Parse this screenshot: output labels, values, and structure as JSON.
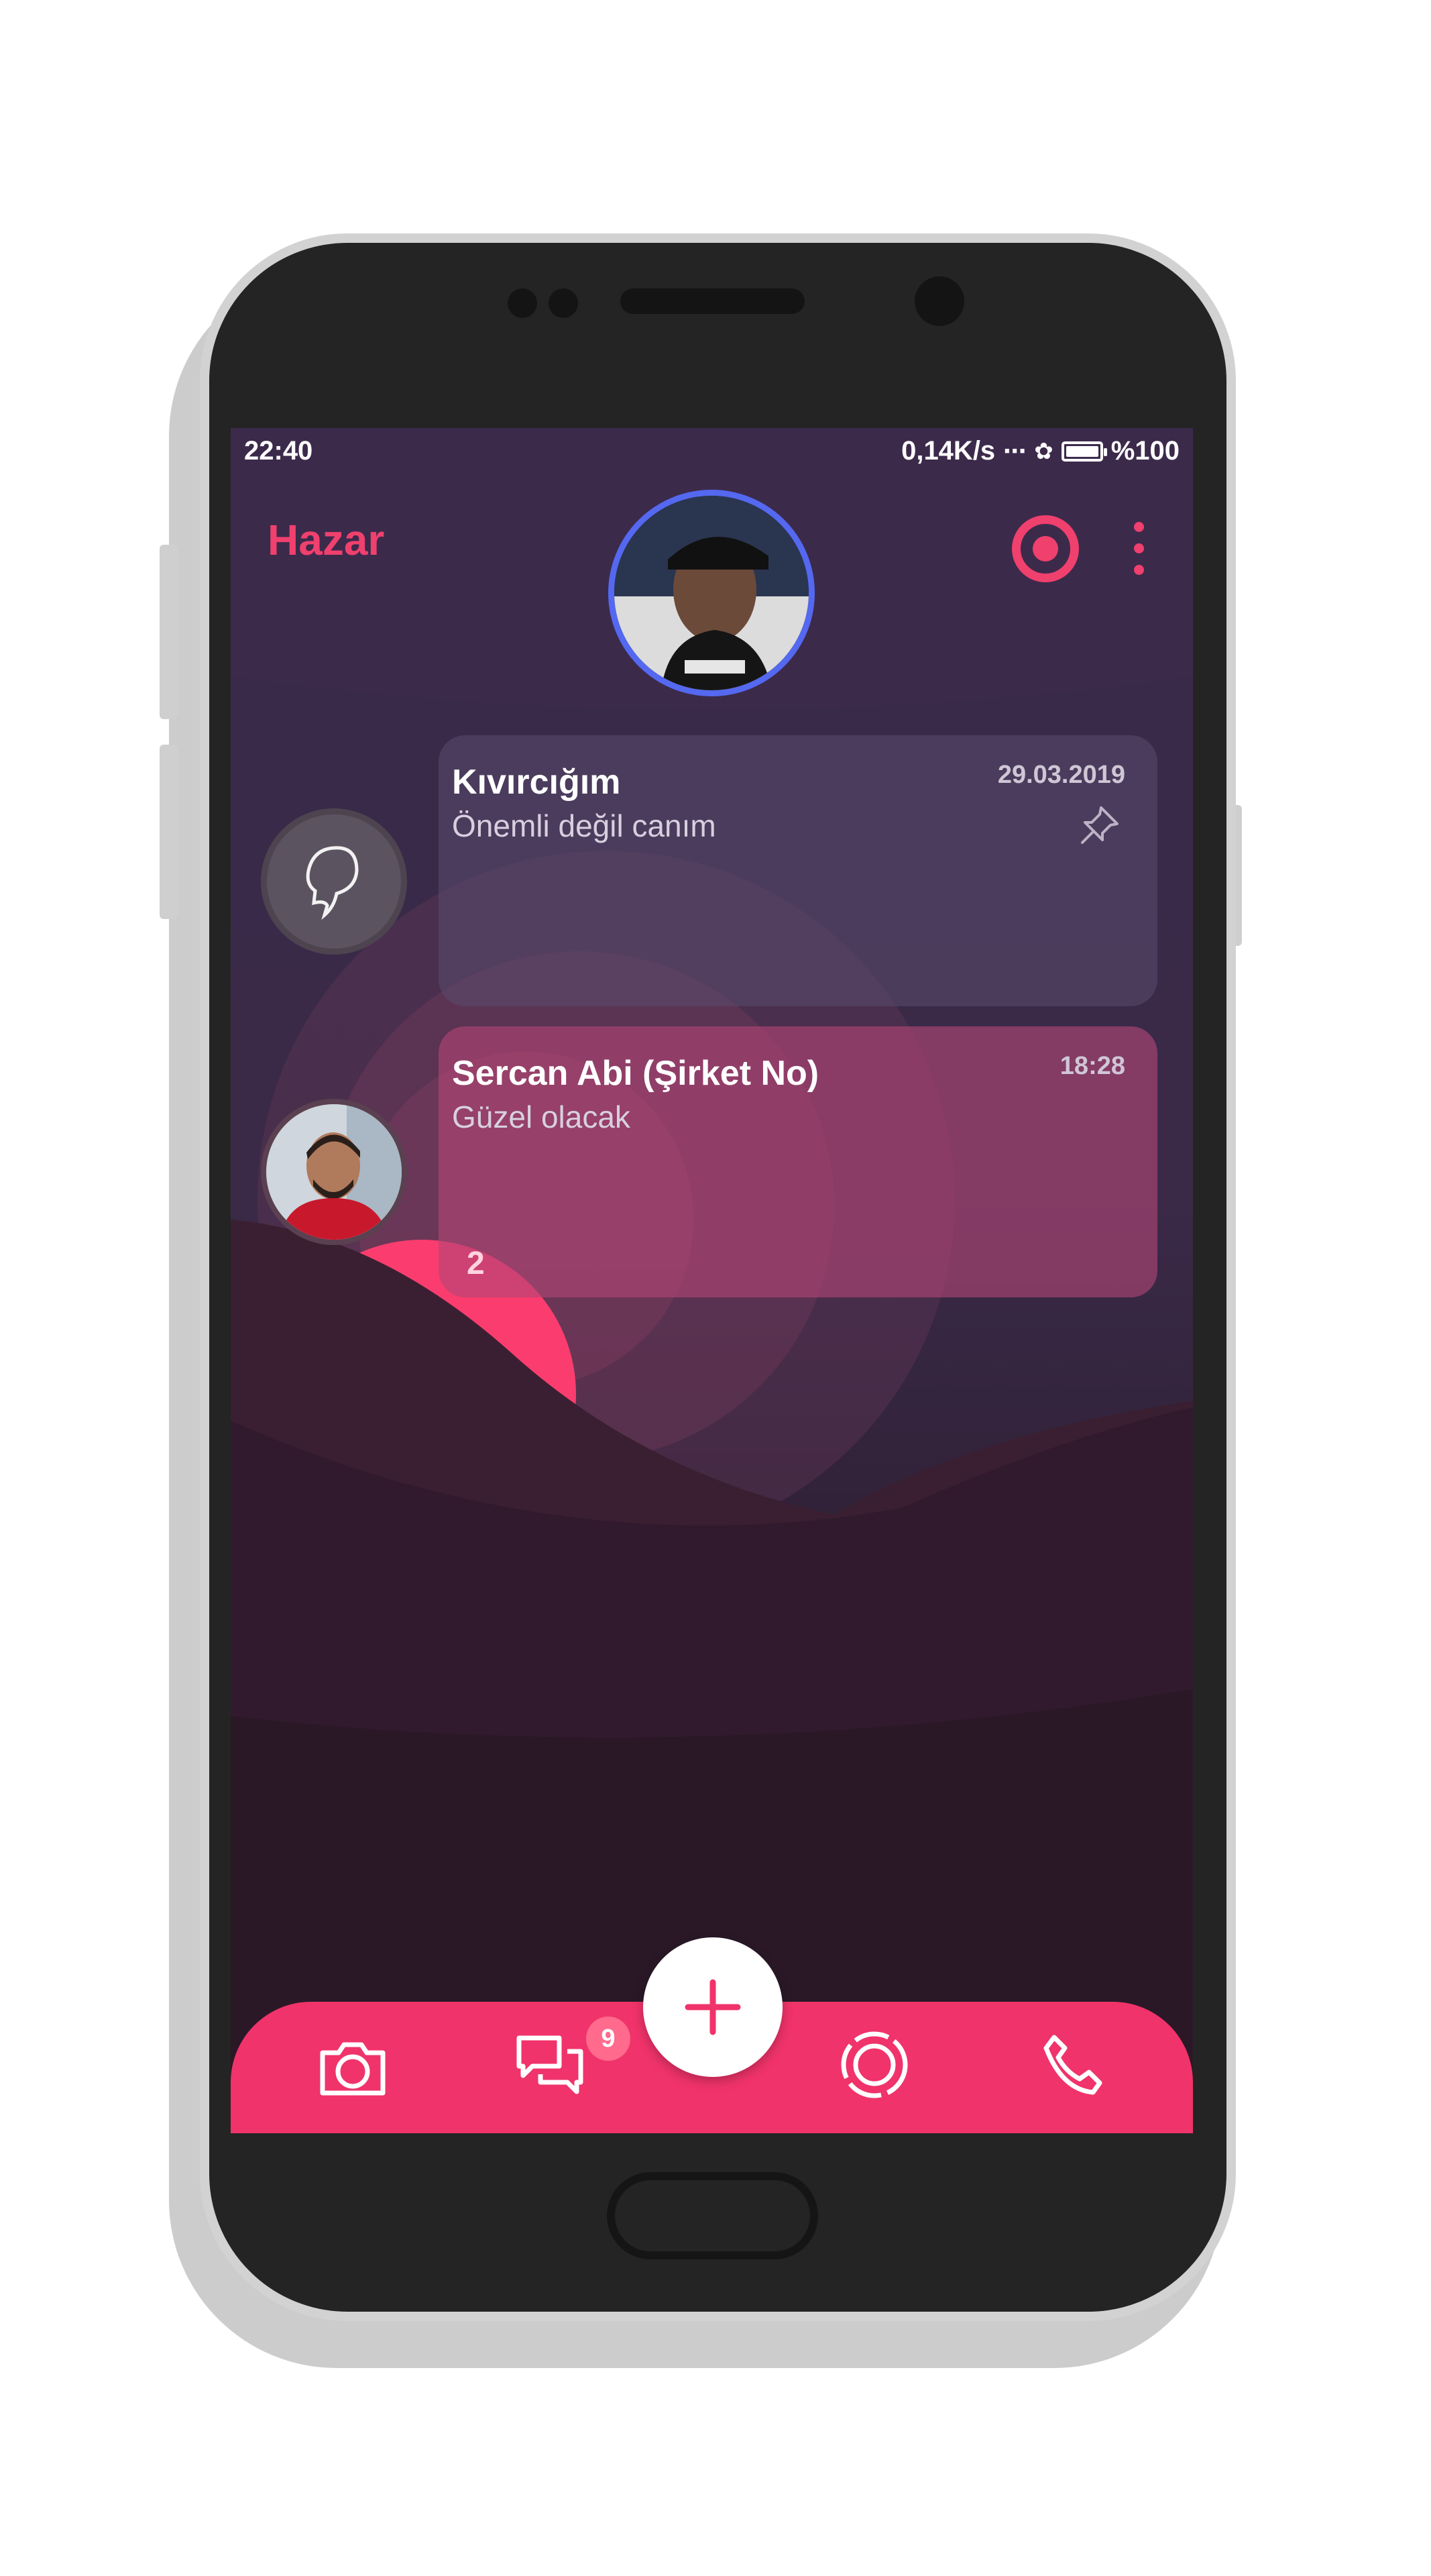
{
  "status_bar": {
    "time": "22:40",
    "network_speed": "0,14K/s",
    "battery_text": "%100",
    "icons": [
      "signal-icon",
      "fan-icon",
      "battery-icon"
    ]
  },
  "header": {
    "app_title": "Hazar",
    "profile_avatar": "profile-avatar",
    "actions": [
      "record-icon",
      "more-vertical-icon"
    ]
  },
  "chats": [
    {
      "name": "Kıvırcığım",
      "last_message": "Önemli değil canım",
      "time": "29.03.2019",
      "pinned": true,
      "avatar": "silhouette-icon"
    },
    {
      "name": "Sercan Abi (Şirket No)",
      "last_message": "Güzel olacak",
      "time": "18:28",
      "unread_count": "2",
      "avatar": "contact-photo"
    }
  ],
  "bottom_nav": {
    "items": [
      "camera-icon",
      "chats-icon",
      "status-icon",
      "phone-icon"
    ],
    "chats_badge": "9",
    "fab": "plus-icon"
  },
  "colors": {
    "accent": "#f0336a",
    "title": "#f0406e",
    "avatar_ring": "#5468f0",
    "background": "#3a2a4a"
  }
}
